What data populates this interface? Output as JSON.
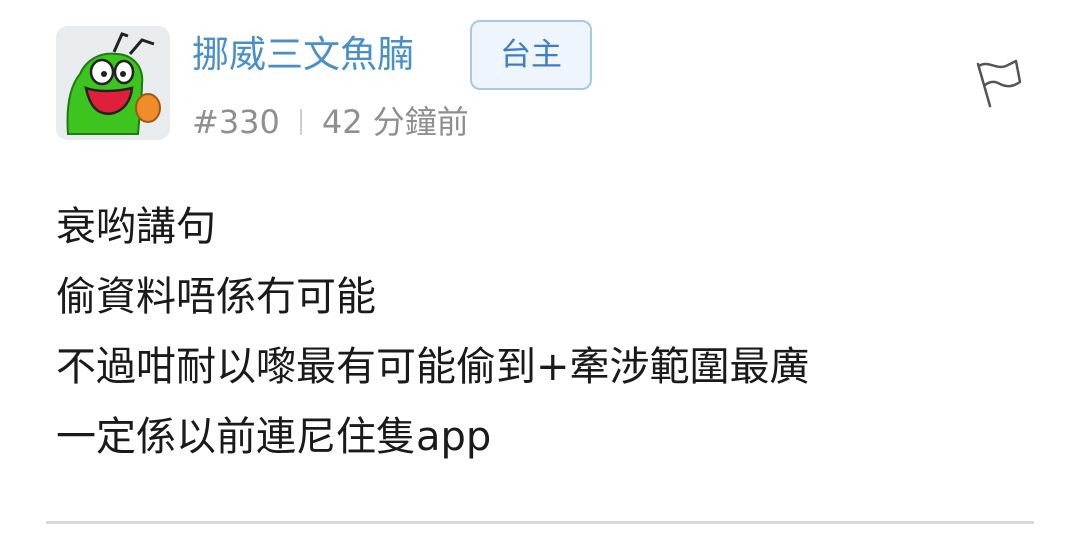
{
  "post": {
    "username": "挪威三文魚腩",
    "op_badge": "台主",
    "floor": "#330",
    "time": "42 分鐘前",
    "content_lines": [
      "衰哟講句",
      "偷資料唔係冇可能",
      "不過咁耐以嚟最有可能偷到+牽涉範圍最廣",
      "一定係以前連尼住隻app"
    ],
    "avatar_icon": "green-frog-avatar-icon",
    "report_icon": "flag-icon"
  },
  "colors": {
    "username": "#4a90c8",
    "badge_text": "#3f7fbf",
    "badge_border": "#a9c8e6",
    "badge_bg": "#eef5fc",
    "meta": "#8f8f8f",
    "content": "#1a1a1a",
    "divider": "#d9d9d9"
  }
}
